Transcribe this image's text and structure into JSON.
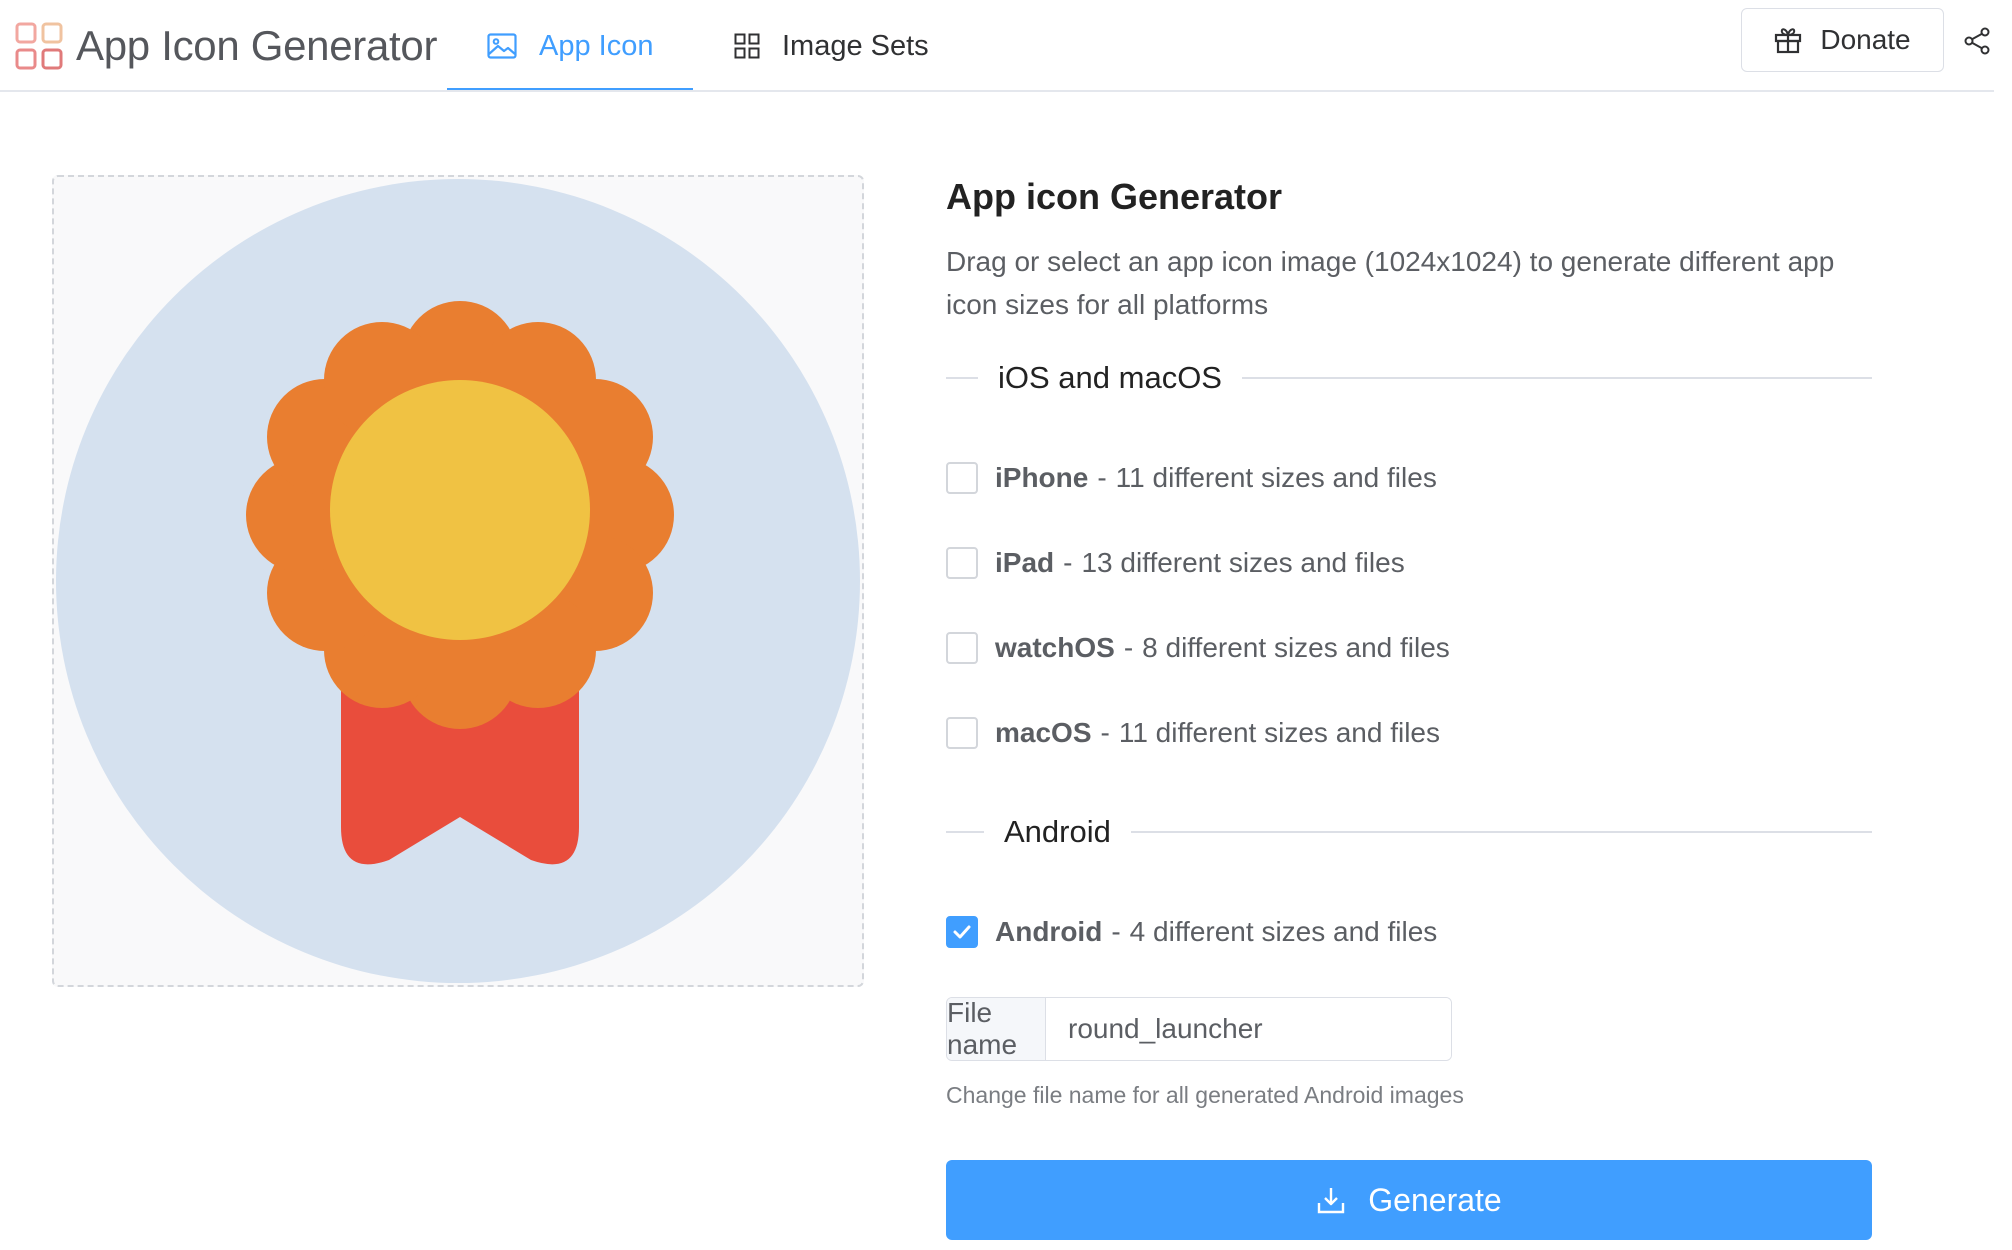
{
  "header": {
    "brand_title": "App Icon Generator",
    "brand_logo": "grid-logo-icon",
    "tabs": [
      {
        "label": "App Icon",
        "icon": "image-icon",
        "active": true
      },
      {
        "label": "Image Sets",
        "icon": "grid-icon",
        "active": false
      }
    ],
    "donate_label": "Donate",
    "donate_icon": "gift-icon",
    "share_icon": "share-icon"
  },
  "preview": {
    "image": "award-ribbon-illustration"
  },
  "panel": {
    "title": "App icon Generator",
    "description": "Drag or select an app icon image (1024x1024) to generate different app icon sizes for all platforms",
    "sections": [
      {
        "title": "iOS and macOS",
        "options": [
          {
            "name": "iPhone",
            "detail": "11 different sizes and files",
            "checked": false
          },
          {
            "name": "iPad",
            "detail": "13 different sizes and files",
            "checked": false
          },
          {
            "name": "watchOS",
            "detail": "8 different sizes and files",
            "checked": false
          },
          {
            "name": "macOS",
            "detail": "11 different sizes and files",
            "checked": false
          }
        ]
      },
      {
        "title": "Android",
        "options": [
          {
            "name": "Android",
            "detail": "4 different sizes and files",
            "checked": true
          }
        ]
      }
    ],
    "separator": "-",
    "file_name": {
      "label": "File name",
      "value": "round_launcher",
      "hint": "Change file name for all generated Android images"
    },
    "generate_label": "Generate",
    "generate_icon": "download-icon"
  },
  "colors": {
    "accent": "#409eff",
    "medal_outer": "#e97e30",
    "medal_inner": "#f0c243",
    "ribbon": "#e94d3c",
    "preview_circle": "#d5e1ef"
  }
}
